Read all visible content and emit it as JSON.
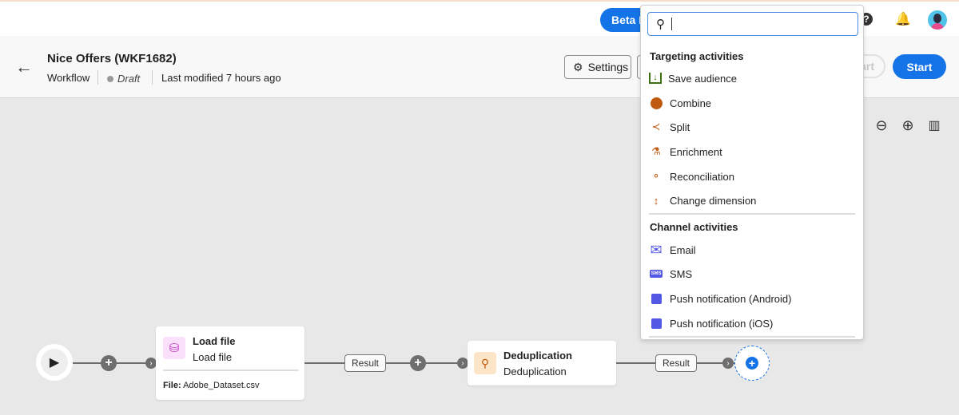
{
  "topbar": {
    "beta_label": "Beta F"
  },
  "header": {
    "title": "Nice Offers (WKF1682)",
    "type": "Workflow",
    "status": "Draft",
    "modified": "Last modified 7 hours ago",
    "settings_label": "Settings",
    "restart_label": "art",
    "start_label": "Start"
  },
  "menu": {
    "search_placeholder": "",
    "sections": [
      {
        "title": "Targeting activities",
        "items": [
          {
            "label": "Save audience"
          },
          {
            "label": "Combine"
          },
          {
            "label": "Split"
          },
          {
            "label": "Enrichment"
          },
          {
            "label": "Reconciliation"
          },
          {
            "label": "Change dimension"
          }
        ]
      },
      {
        "title": "Channel activities",
        "items": [
          {
            "label": "Email"
          },
          {
            "label": "SMS"
          },
          {
            "label": "Push notification (Android)"
          },
          {
            "label": "Push notification (iOS)"
          }
        ]
      }
    ]
  },
  "canvas": {
    "load_file": {
      "title": "Load file",
      "subtitle": "Load file",
      "file_label": "File:",
      "file_value": "Adobe_Dataset.csv"
    },
    "dedup": {
      "title": "Deduplication",
      "subtitle": "Deduplication"
    },
    "result_label": "Result"
  },
  "colors": {
    "accent": "#1473e6",
    "targeting": "#c05a10",
    "channel": "#5258e4"
  }
}
